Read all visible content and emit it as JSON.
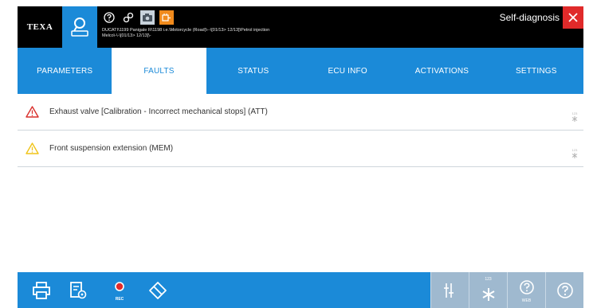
{
  "header": {
    "logo_text": "TEXA",
    "vehicle_path_line1": "DUCATI\\1199 Panigale R\\1198 i.e.\\Motorcycle (Road)\\--\\[01/13> 12/13]\\Petrol injection",
    "vehicle_path_line2": "Melco\\-\\-\\[01/13> 12/13]\\-",
    "mode_label": "Self-diagnosis",
    "icons": [
      "vehicle-select-icon",
      "help-icon",
      "link-icon",
      "camera-icon",
      "ecu-connect-icon",
      "close-icon"
    ]
  },
  "tabs": [
    {
      "label": "PARAMETERS",
      "active": false
    },
    {
      "label": "FAULTS",
      "active": true
    },
    {
      "label": "STATUS",
      "active": false
    },
    {
      "label": "ECU INFO",
      "active": false
    },
    {
      "label": "ACTIVATIONS",
      "active": false
    },
    {
      "label": "SETTINGS",
      "active": false
    }
  ],
  "faults": [
    {
      "text": "Exhaust valve [Calibration - Incorrect mechanical stops] (ATT)",
      "severity": "red"
    },
    {
      "text": "Front suspension extension (MEM)",
      "severity": "yellow"
    }
  ],
  "toolbar": {
    "rec_label": "REC",
    "code_label": "123",
    "web_label": "WEB",
    "icons": [
      "print-icon",
      "report-settings-icon",
      "record-icon",
      "erase-icon",
      "adjust-icon",
      "freeze-frame-icon",
      "web-help-icon",
      "help-icon"
    ]
  },
  "colors": {
    "accent": "#1b8ad8",
    "close": "#e02a2a",
    "warning_red": "#d9302c",
    "warning_yellow": "#f0c419",
    "disabled": "#9fb9cf",
    "orange": "#f08a1c"
  }
}
